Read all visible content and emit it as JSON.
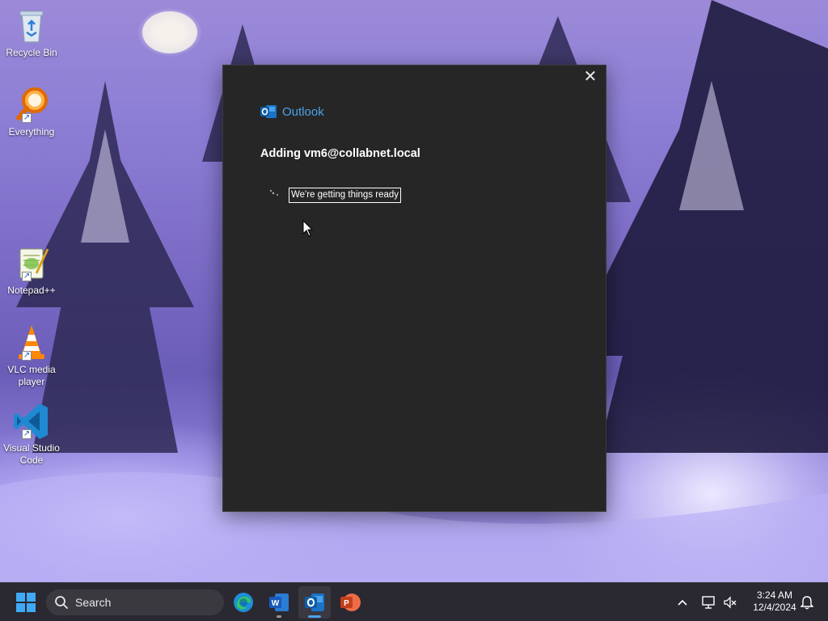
{
  "desktop": {
    "icons": [
      {
        "label": "Recycle Bin",
        "icon": "recycle-bin-icon"
      },
      {
        "label": "Everything",
        "icon": "everything-search-icon"
      },
      {
        "label": "Notepad++",
        "icon": "notepad-plus-plus-icon"
      },
      {
        "label": "VLC media player",
        "icon": "vlc-cone-icon"
      },
      {
        "label": "Visual Studio Code",
        "icon": "vscode-icon"
      }
    ]
  },
  "dialog": {
    "app_name": "Outlook",
    "heading": "Adding vm6@collabnet.local",
    "status": "We're getting things ready",
    "close_icon": "close-icon"
  },
  "taskbar": {
    "search_label": "Search",
    "apps": [
      {
        "name": "Microsoft Edge",
        "icon": "edge-icon"
      },
      {
        "name": "Microsoft Word",
        "icon": "word-icon"
      },
      {
        "name": "Microsoft Outlook",
        "icon": "outlook-icon"
      },
      {
        "name": "Microsoft PowerPoint",
        "icon": "powerpoint-icon"
      }
    ],
    "time": "3:24 AM",
    "date": "12/4/2024"
  },
  "colors": {
    "dialog_bg": "#262626",
    "outlook_blue": "#4aa3ea",
    "taskbar_bg": "#2a2830"
  }
}
